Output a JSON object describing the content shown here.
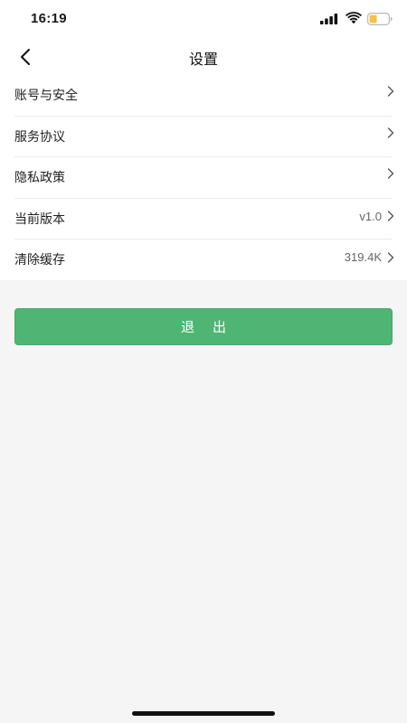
{
  "status_bar": {
    "time": "16:19"
  },
  "nav": {
    "title": "设置"
  },
  "settings": [
    {
      "label": "账号与安全",
      "value": ""
    },
    {
      "label": "服务协议",
      "value": ""
    },
    {
      "label": "隐私政策",
      "value": ""
    },
    {
      "label": "当前版本",
      "value": "v1.0"
    },
    {
      "label": "清除缓存",
      "value": "319.4K"
    }
  ],
  "logout": {
    "label": "退出"
  },
  "colors": {
    "accent": "#4fb574",
    "background": "#f5f5f5",
    "battery": "#f6c343"
  },
  "icons": [
    "signal-icon",
    "wifi-icon",
    "battery-icon",
    "back-arrow-icon",
    "chevron-right-icon"
  ]
}
